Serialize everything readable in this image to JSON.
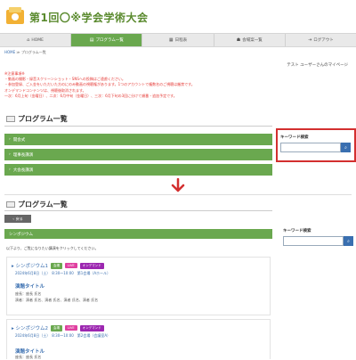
{
  "site": {
    "title": "第1回〇※学会学術大会"
  },
  "nav": [
    {
      "label": "HOME",
      "icon": "home-icon",
      "glyph": "⌂"
    },
    {
      "label": "プログラム一覧",
      "icon": "program-list-icon",
      "glyph": "▤"
    },
    {
      "label": "日程表",
      "icon": "calendar-icon",
      "glyph": "▦"
    },
    {
      "label": "会場案一覧",
      "icon": "group-icon",
      "glyph": "☗"
    },
    {
      "label": "ログアウト",
      "icon": "logout-icon",
      "glyph": "⇥"
    }
  ],
  "breadcrumb": {
    "home": "HOME",
    "sep": "≫",
    "current": "プログラム一覧"
  },
  "mypage": "テスト ユーザーさんのマイページ",
  "notice": [
    "※注意事項※",
    "・動画の撮影・録音スクリーンショット・SNSへの投稿はご遠慮ください。",
    "・参加登録、ご入金をいただいた方のにのみ動画の視聴権があります。1つのアカウントで複数名のご視聴は厳禁です。",
    "オンデマンドコンテンツは、視聴後取消されます。",
    "一次：6月上旬（金曜日）、二次：6月中旬（金曜日）、三次：6月下旬の3回に分けて順番・追加予定です。"
  ],
  "section": {
    "title": "プログラム一覧"
  },
  "accordions": [
    {
      "label": "開会式"
    },
    {
      "label": "理事長講演"
    },
    {
      "label": "大会長講演"
    }
  ],
  "search": {
    "label": "キーワード検索",
    "placeholder": ""
  },
  "lower": {
    "back": "戻る",
    "category": "シンポジウム",
    "instruction": "以下より、ご覧になりたい講演をクリックしてください。",
    "cards": [
      {
        "name": "シンポジウム1",
        "badges": [
          "会場",
          "LIVE",
          "オンデマンド"
        ],
        "meta": "2024年6月8日（土）　8:30〜10:00　第1会場（Aホール）",
        "talk_title": "演題タイトル",
        "chair": "座長：座長 氏名",
        "speakers": "演者：演者 氏名、演者 氏名、演者 氏名、演者 氏名"
      },
      {
        "name": "シンポジウム2",
        "badges": [
          "会場",
          "LIVE",
          "オンデマンド"
        ],
        "meta": "2024年6月8日（土）　8:30〜10:00　第2会場（会議室A）",
        "talk_title": "演題タイトル",
        "chair": "座長：座長 氏名",
        "speakers": "演者：演者 氏名"
      }
    ]
  },
  "colors": {
    "green": "#6aa84f",
    "blue": "#3a6fb0",
    "red": "#d32f2f"
  }
}
